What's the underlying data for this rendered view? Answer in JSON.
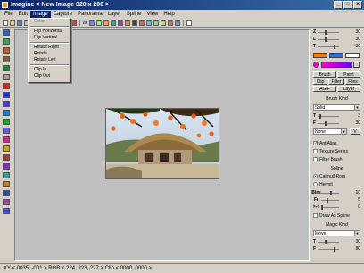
{
  "window": {
    "title": "Imagine < New Image 320 x 200 >",
    "buttons": [
      "_",
      "□",
      "x"
    ]
  },
  "menubar": {
    "items": [
      "File",
      "Edit",
      "Image",
      "Capture",
      "Panorama",
      "Layer",
      "Spline",
      "View",
      "Help"
    ],
    "active": "Image"
  },
  "toolbar": {
    "zoom_glyph": "Ix"
  },
  "image_menu": {
    "items": [
      {
        "label": "Color",
        "disabled": true
      },
      {
        "label": "Flip Horizontal"
      },
      {
        "label": "Flip Vertical"
      },
      {
        "label": "Rotate Right"
      },
      {
        "label": "Rotate"
      },
      {
        "label": "Rotate Left"
      },
      {
        "label": "Clip In"
      },
      {
        "label": "Clip Out"
      }
    ]
  },
  "panel": {
    "z": {
      "label": "Z",
      "value": "30"
    },
    "l": {
      "label": "L",
      "value": "30"
    },
    "t": {
      "label": "T",
      "value": "80"
    },
    "colors": {
      "primary": "#ff7a00",
      "secondary": "#2f6fe0",
      "tertiary": "#ffffff",
      "gradient_from": "#ff00cc",
      "gradient_to": "#6a00ff"
    },
    "buttons": [
      "Brush",
      "Paint",
      "Clip",
      "Filter",
      "Files",
      "AGIF",
      "Layer"
    ],
    "brush_kind": {
      "title": "Brush Kind",
      "mode": "Solid",
      "t": "3",
      "f": "30",
      "blend": "None",
      "blend_key": "V"
    },
    "options": {
      "antialias": "AntiAlias",
      "texture": "Texture Series",
      "filter_brush": "Filter Brush"
    },
    "spline": {
      "title": "Spline",
      "catmull": "Catmull-Rom",
      "hermit": "Hermit",
      "bias_label": "Bias",
      "bias": "10",
      "fr_label": "Fr",
      "fr": "5",
      "ss_label": ">-<",
      "ss": "0",
      "draw_as_spline": "Draw As Spline"
    },
    "magic": {
      "title": "Magic Kind",
      "mode": "Move",
      "t": "30",
      "f": "80"
    }
  },
  "status": {
    "text": "XY < 0035, -001 > RGB < 224, 223, 227 > Clip < 0000, 0000 >"
  }
}
